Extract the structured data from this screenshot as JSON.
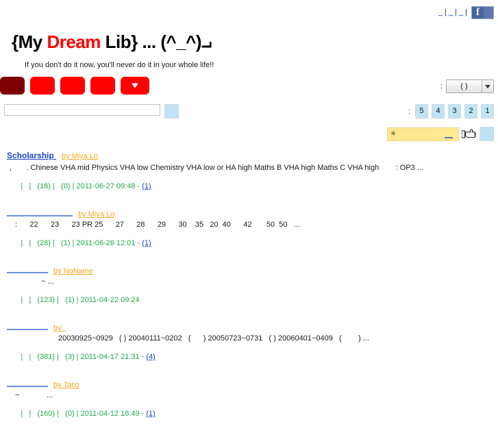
{
  "topbar": {
    "links": [
      "_",
      "_",
      "_"
    ],
    "separator": "|",
    "facebook_label": "f"
  },
  "header": {
    "title_prefix": "{My ",
    "title_accent": "Dream",
    "title_suffix": " Lib} ... (^_^)⨼",
    "tagline": "If you don't do it now, you'll never do it in your whole life!!",
    "accent_color": "#ff0000"
  },
  "nav": {
    "buttons": [
      {
        "label": "",
        "active": true
      },
      {
        "label": "",
        "active": false
      },
      {
        "label": "",
        "active": false
      },
      {
        "label": "",
        "active": false
      },
      {
        "label": "",
        "active": false,
        "caret": true
      }
    ],
    "active_color": "#7e0000",
    "color": "#fe0000"
  },
  "search": {
    "value": "",
    "placeholder": "",
    "button_label": ""
  },
  "category_select": {
    "label": ":",
    "value": "( )"
  },
  "pager": {
    "label": ":",
    "pages": [
      "5",
      "4",
      "3",
      "2",
      "1"
    ]
  },
  "keyword_search": {
    "label": ":",
    "star": "✳",
    "value": "",
    "button_label": ""
  },
  "posts": [
    {
      "title": "Scholarship ",
      "title_blank": false,
      "author": "by Miya Lo",
      "desc": ",       . Chinese VHA mid Physics VHA low Chemistry VHA low or HA high Maths B VHA high Maths C VHA high        : OP3 ...",
      "desc_indent": "indent-a",
      "meta": "|   |   (18) |   (0) | 2011-06-27 09:48 - ",
      "reply": "(1)"
    },
    {
      "title": "",
      "title_blank": true,
      "title_width": "w1",
      "author": "by Miya Lo",
      "desc": ":      22      23      23 PR 25      27      28      29      30    35   20  40      42       50  50   ...",
      "desc_indent": "indent-e",
      "meta": "|   |   (28) |   (1) | 2011-06-26 12:01 - ",
      "reply": "(1)"
    },
    {
      "title": "",
      "title_blank": true,
      "title_width": "w2",
      "author": "by NoName",
      "desc": "~ ...",
      "desc_indent": "indent-c",
      "meta": "|   |   (123) |   (1) | 2011-04-22 09:24",
      "reply": ""
    },
    {
      "title": "",
      "title_blank": true,
      "title_width": "w3",
      "author": "by  ",
      "desc": "20030925~0929   ( ) 20040111~0202   (      ) 20050723~0731   ( ) 20060401~0409   (        ) ...",
      "desc_indent": "indent-d",
      "meta": "|   |   (381) |   (3) | 2011-04-17 21:31 - ",
      "reply": "(4)"
    },
    {
      "title": "",
      "title_blank": true,
      "title_width": "w4",
      "author": "by Taco",
      "desc": "~             ...",
      "desc_indent": "indent-e",
      "meta": "|   |   (160) |   (0) | 2011-04-12 16:49 - ",
      "reply": "(1)"
    }
  ]
}
